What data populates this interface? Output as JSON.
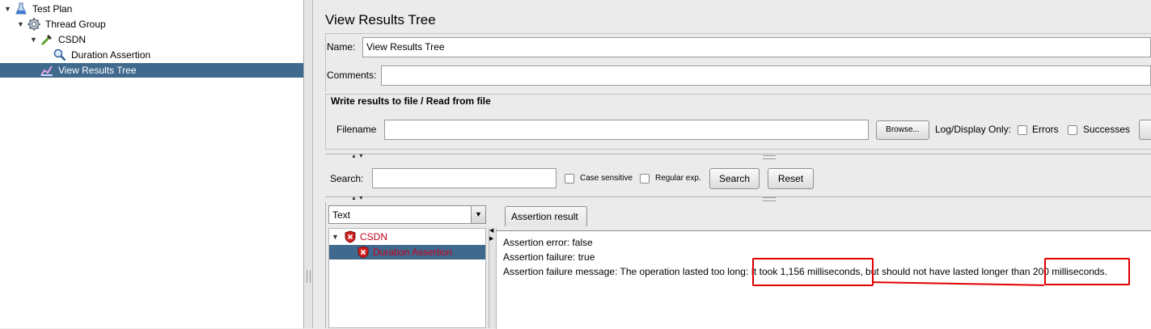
{
  "tree": {
    "items": [
      {
        "label": "Test Plan",
        "icon": "flask-icon"
      },
      {
        "label": "Thread Group",
        "icon": "gear-icon"
      },
      {
        "label": "CSDN",
        "icon": "pipette-icon"
      },
      {
        "label": "Duration Assertion",
        "icon": "magnifier-icon"
      },
      {
        "label": "View Results Tree",
        "icon": "results-icon",
        "selected": true
      }
    ]
  },
  "panel": {
    "title": "View Results Tree",
    "name_label": "Name:",
    "name_value": "View Results Tree",
    "comments_label": "Comments:",
    "comments_value": "",
    "file_section_title": "Write results to file / Read from file",
    "filename_label": "Filename",
    "filename_value": "",
    "browse_label": "Browse...",
    "log_display_label": "Log/Display Only:",
    "errors_label": "Errors",
    "successes_label": "Successes",
    "search_label": "Search:",
    "search_value": "",
    "case_sensitive_label": "Case sensitive",
    "regular_exp_label": "Regular exp.",
    "search_button": "Search",
    "reset_button": "Reset"
  },
  "results": {
    "renderer_selected": "Text",
    "tree": [
      {
        "label": "CSDN",
        "status": "failed"
      },
      {
        "label": "Duration Assertion",
        "status": "failed",
        "selected": true
      }
    ],
    "tab_label": "Assertion result",
    "lines": {
      "error": "Assertion error: false",
      "failure": "Assertion failure: true",
      "message_prefix": "Assertion failure message: The operation lasted too long:",
      "message_took": "It took 1,156 milliseconds",
      "message_mid": ", but should not have lasted longer than",
      "message_limit": "200 milliseconds."
    }
  },
  "colors": {
    "selection": "#3f6a8e",
    "error_text": "#c8001e",
    "annotation": "#e00000"
  }
}
